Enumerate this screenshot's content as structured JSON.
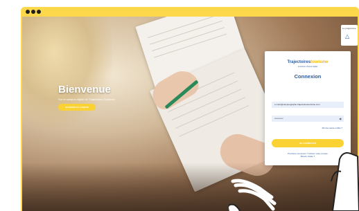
{
  "window": {
    "controls": [
      "close",
      "minimize",
      "maximize"
    ]
  },
  "hero": {
    "title": "Bienvenue",
    "subtitle": "Sur le campus digital de Trajectoires Tourisme",
    "cta_label": "ACCÉDER AU CAMPUS"
  },
  "badge": {
    "text": "Le programme",
    "icon": "triangle-icon"
  },
  "login": {
    "logo_main": "Trajectoires",
    "logo_accent": "tourisme",
    "logo_sub": "Inventeurs d'avenir digital",
    "title": "Connexion",
    "email_value": "e.marc@campusgraphe.trajectoirestourisme.com",
    "password_value": "••••••••••••",
    "forgot_label": "Mot de passe oublié ?",
    "submit_label": "SE CONNECTER",
    "activate_line1": "Première connexion ? Activez votre compte",
    "activate_line2": "Besoin d'aide ?"
  },
  "colors": {
    "accent_yellow": "#fbd233",
    "brand_blue": "#2c5aa0",
    "frame": "#fcd84a"
  }
}
